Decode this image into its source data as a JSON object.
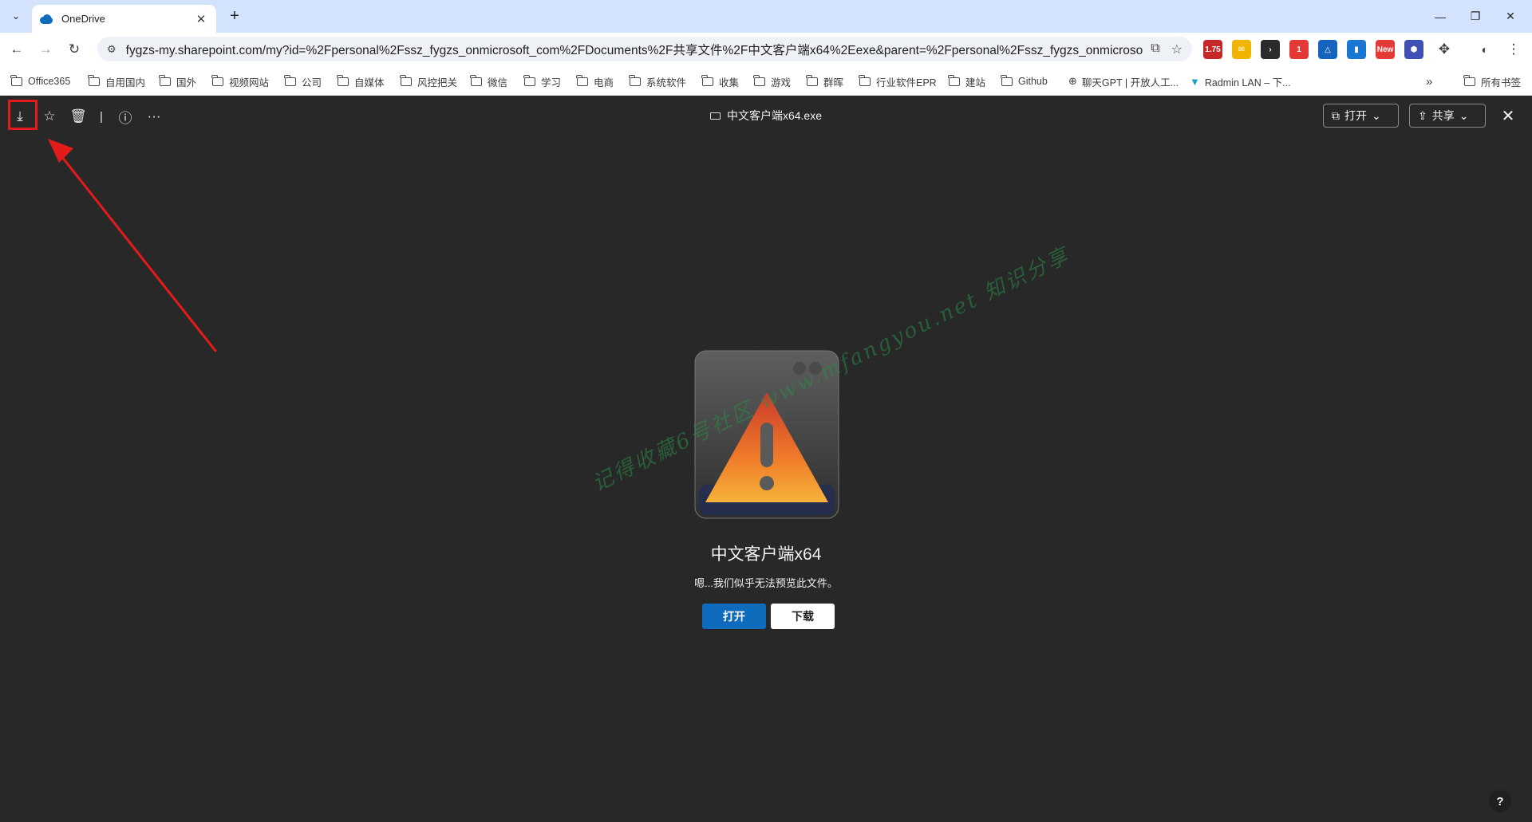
{
  "tabstrip": {
    "tab_title": "OneDrive",
    "tab_close": "✕",
    "new_tab": "+",
    "minimize": "—",
    "restore": "❐",
    "close": "✕"
  },
  "toolbar": {
    "url": "fygzs-my.sharepoint.com/my?id=%2Fpersonal%2Fssz_fygzs_onmicrosoft_com%2FDocuments%2F共享文件%2F中文客户端x64%2Eexe&parent=%2Fpersonal%2Fssz_fygzs_onmicrosoft_com..."
  },
  "extensions": [
    {
      "label": "1.75",
      "color": "#c62828"
    },
    {
      "label": "✉",
      "color": "#f1b400"
    },
    {
      "label": "›",
      "color": "#2b2b2b"
    },
    {
      "label": "1",
      "color": "#e53935"
    },
    {
      "label": "△",
      "color": "#1565c0"
    },
    {
      "label": "▮",
      "color": "#1976d2"
    },
    {
      "label": "New",
      "color": "#e53935"
    },
    {
      "label": "⬢",
      "color": "#3f51b5"
    }
  ],
  "bookmarks": {
    "items": [
      "Office365",
      "自用国内",
      "国外",
      "视频网站",
      "公司",
      "自媒体",
      "风控把关",
      "微信",
      "学习",
      "电商",
      "系统软件",
      "收集",
      "游戏",
      "群晖",
      "行业软件EPR",
      "建站",
      "Github"
    ],
    "chat_gpt": "聊天GPT | 开放人工...",
    "radmin": "Radmin LAN – 下...",
    "more": "»",
    "all": "所有书签"
  },
  "viewer": {
    "file_title": "中文客户端x64.exe",
    "open_label": "打开",
    "share_label": "共享",
    "preview_title": "中文客户端x64",
    "preview_message": "嗯...我们似乎无法预览此文件。",
    "open_button": "打开",
    "download_button": "下载",
    "help": "?"
  },
  "watermark": "记得收藏6号社区 www.mfangyou.net 知识分享"
}
